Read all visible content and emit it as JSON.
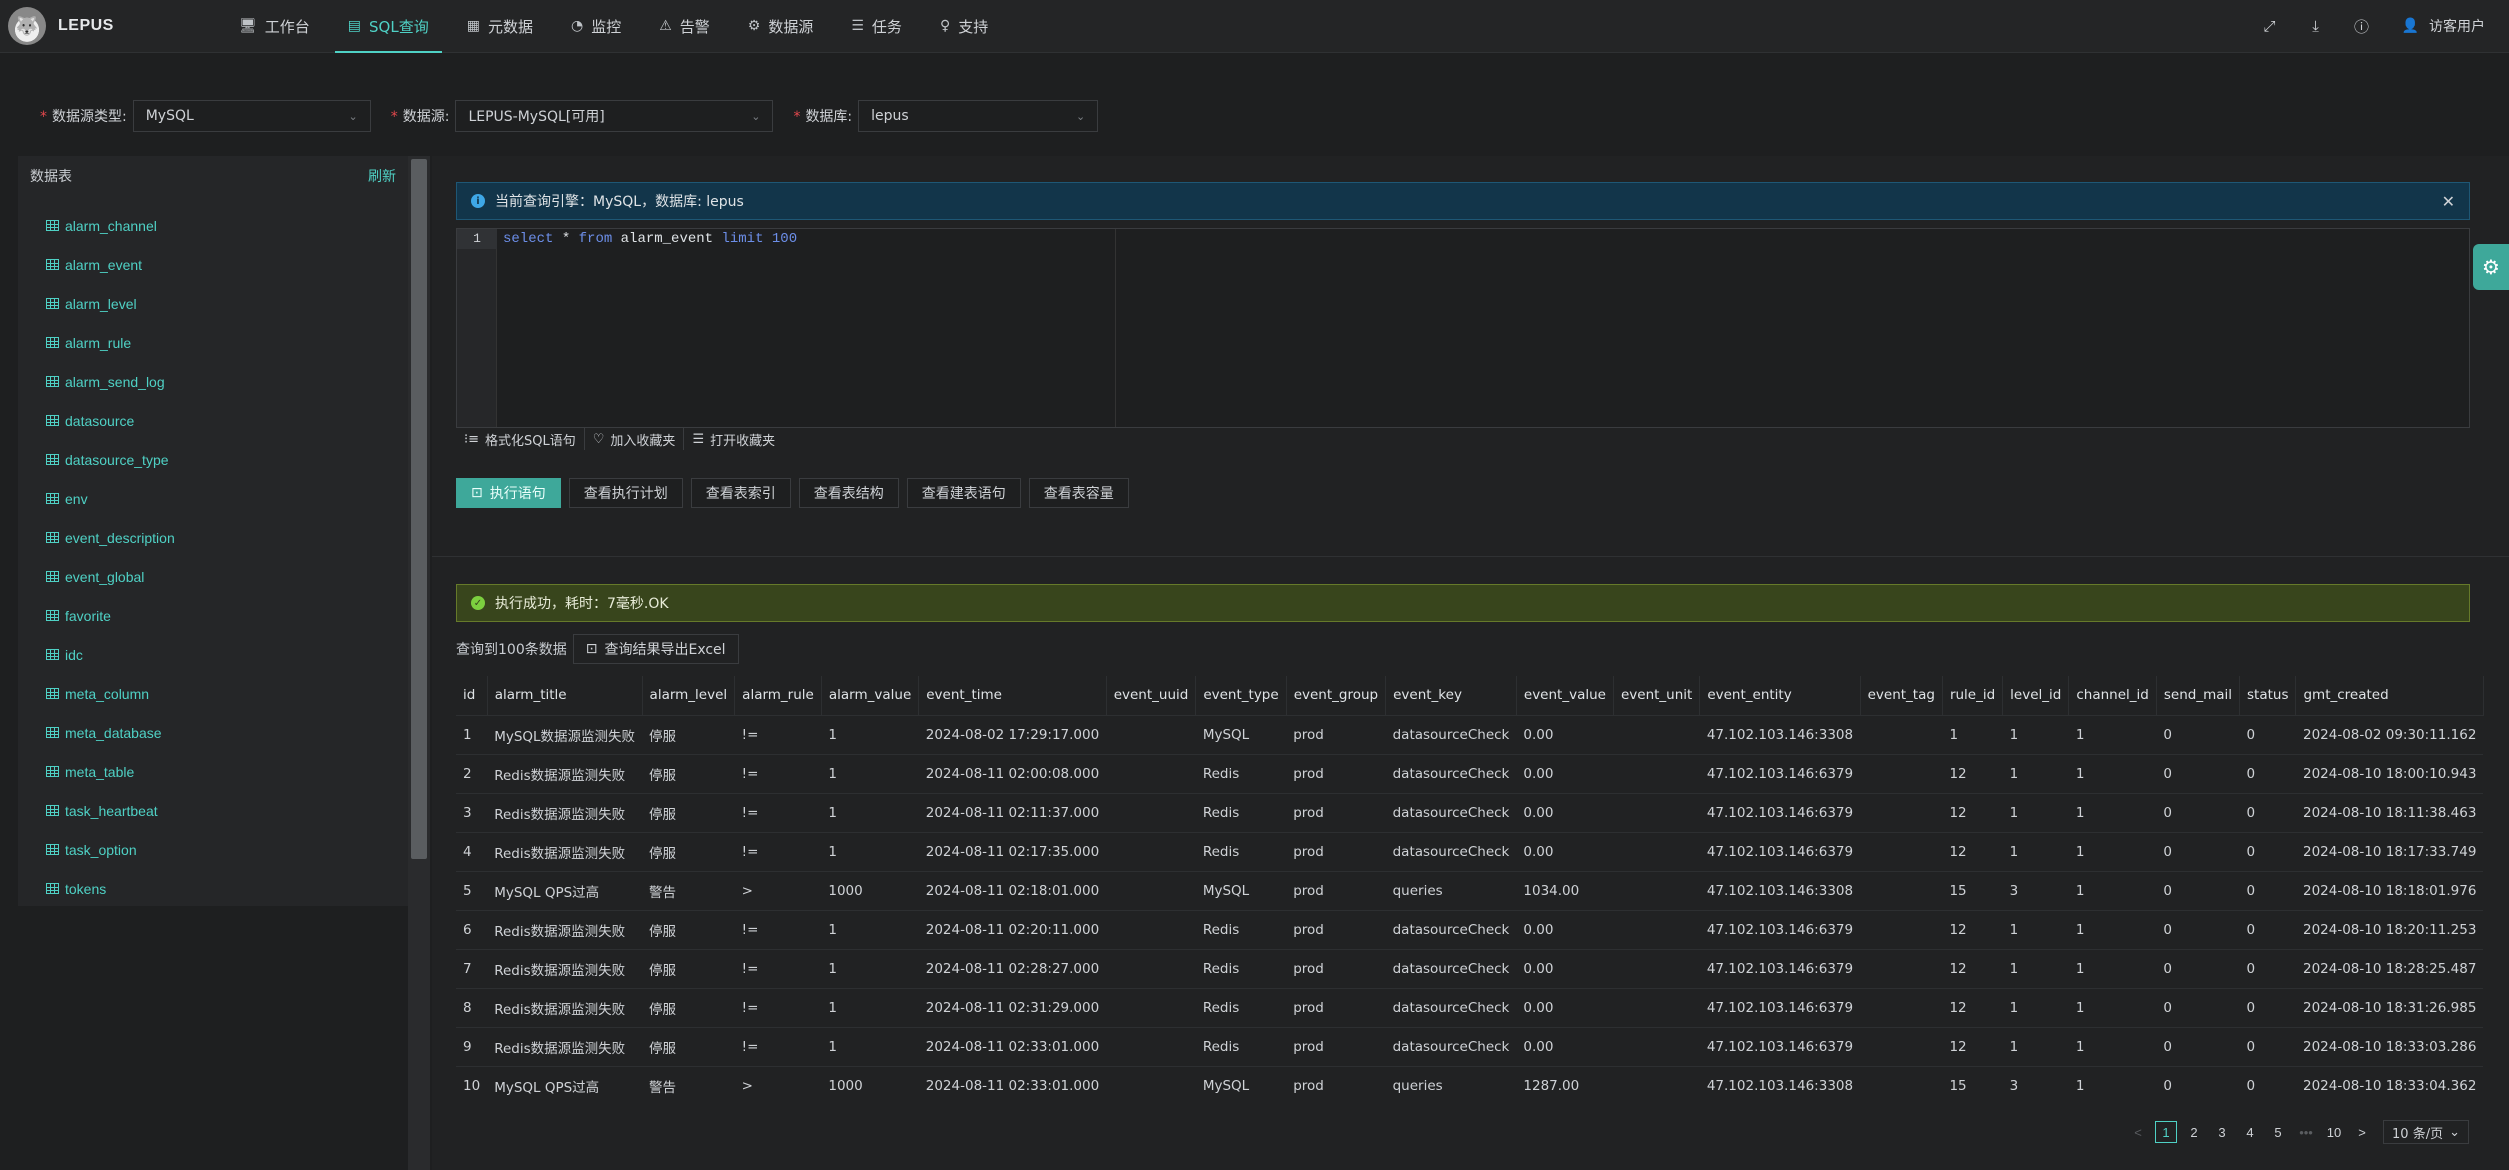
{
  "app": {
    "name": "LEPUS"
  },
  "nav": [
    {
      "label": "工作台",
      "icon": "monitor-icon",
      "glyph": "🖥",
      "active": false
    },
    {
      "label": "SQL查询",
      "icon": "sql-icon",
      "glyph": "▤",
      "active": true
    },
    {
      "label": "元数据",
      "icon": "metadata-icon",
      "glyph": "▦",
      "active": false
    },
    {
      "label": "监控",
      "icon": "gauge-icon",
      "glyph": "◔",
      "active": false
    },
    {
      "label": "告警",
      "icon": "warning-icon",
      "glyph": "⚠",
      "active": false
    },
    {
      "label": "数据源",
      "icon": "gear-icon",
      "glyph": "⚙",
      "active": false
    },
    {
      "label": "任务",
      "icon": "task-list-icon",
      "glyph": "☰",
      "active": false
    },
    {
      "label": "支持",
      "icon": "bulb-icon",
      "glyph": "♀",
      "active": false
    }
  ],
  "user": {
    "name": "访客用户"
  },
  "filters": {
    "datasource_type_label": "数据源类型:",
    "datasource_type_value": "MySQL",
    "datasource_label": "数据源:",
    "datasource_value": "LEPUS-MySQL[可用]",
    "database_label": "数据库:",
    "database_value": "lepus"
  },
  "sidebar": {
    "title": "数据表",
    "refresh_label": "刷新",
    "tables": [
      "alarm_channel",
      "alarm_event",
      "alarm_level",
      "alarm_rule",
      "alarm_send_log",
      "datasource",
      "datasource_type",
      "env",
      "event_description",
      "event_global",
      "favorite",
      "idc",
      "meta_column",
      "meta_database",
      "meta_table",
      "task_heartbeat",
      "task_option",
      "tokens"
    ]
  },
  "info_alert": {
    "text": "当前查询引擎：MySQL，数据库: lepus"
  },
  "editor": {
    "line_number": "1",
    "tokens": [
      {
        "t": "select",
        "c": "kw"
      },
      {
        "t": " * ",
        "c": "tx"
      },
      {
        "t": "from",
        "c": "kw"
      },
      {
        "t": " alarm_event ",
        "c": "tx"
      },
      {
        "t": "limit",
        "c": "kw"
      },
      {
        "t": " 100",
        "c": "num"
      }
    ]
  },
  "editor_tools": {
    "format_label": "格式化SQL语句",
    "add_fav_label": "加入收藏夹",
    "open_fav_label": "打开收藏夹"
  },
  "actions": {
    "execute": "执行语句",
    "explain": "查看执行计划",
    "indexes": "查看表索引",
    "structure": "查看表结构",
    "ddl": "查看建表语句",
    "capacity": "查看表容量"
  },
  "success_alert": {
    "text": "执行成功，耗时：7毫秒.OK"
  },
  "result": {
    "count_text": "查询到100条数据",
    "export_label": "查询结果导出Excel"
  },
  "table": {
    "columns": [
      "id",
      "alarm_title",
      "alarm_level",
      "alarm_rule",
      "alarm_value",
      "event_time",
      "event_uuid",
      "event_type",
      "event_group",
      "event_key",
      "event_value",
      "event_unit",
      "event_entity",
      "event_tag",
      "rule_id",
      "level_id",
      "channel_id",
      "send_mail",
      "status",
      "gmt_created"
    ],
    "rows": [
      [
        "1",
        "MySQL数据源监测失败",
        "停服",
        "!=",
        "1",
        "2024-08-02 17:29:17.000",
        "",
        "MySQL",
        "prod",
        "datasourceCheck",
        "0.00",
        "",
        "47.102.103.146:3308",
        "",
        "1",
        "1",
        "1",
        "0",
        "0",
        "2024-08-02 09:30:11.162"
      ],
      [
        "2",
        "Redis数据源监测失败",
        "停服",
        "!=",
        "1",
        "2024-08-11 02:00:08.000",
        "",
        "Redis",
        "prod",
        "datasourceCheck",
        "0.00",
        "",
        "47.102.103.146:6379",
        "",
        "12",
        "1",
        "1",
        "0",
        "0",
        "2024-08-10 18:00:10.943"
      ],
      [
        "3",
        "Redis数据源监测失败",
        "停服",
        "!=",
        "1",
        "2024-08-11 02:11:37.000",
        "",
        "Redis",
        "prod",
        "datasourceCheck",
        "0.00",
        "",
        "47.102.103.146:6379",
        "",
        "12",
        "1",
        "1",
        "0",
        "0",
        "2024-08-10 18:11:38.463"
      ],
      [
        "4",
        "Redis数据源监测失败",
        "停服",
        "!=",
        "1",
        "2024-08-11 02:17:35.000",
        "",
        "Redis",
        "prod",
        "datasourceCheck",
        "0.00",
        "",
        "47.102.103.146:6379",
        "",
        "12",
        "1",
        "1",
        "0",
        "0",
        "2024-08-10 18:17:33.749"
      ],
      [
        "5",
        "MySQL QPS过高",
        "警告",
        ">",
        "1000",
        "2024-08-11 02:18:01.000",
        "",
        "MySQL",
        "prod",
        "queries",
        "1034.00",
        "",
        "47.102.103.146:3308",
        "",
        "15",
        "3",
        "1",
        "0",
        "0",
        "2024-08-10 18:18:01.976"
      ],
      [
        "6",
        "Redis数据源监测失败",
        "停服",
        "!=",
        "1",
        "2024-08-11 02:20:11.000",
        "",
        "Redis",
        "prod",
        "datasourceCheck",
        "0.00",
        "",
        "47.102.103.146:6379",
        "",
        "12",
        "1",
        "1",
        "0",
        "0",
        "2024-08-10 18:20:11.253"
      ],
      [
        "7",
        "Redis数据源监测失败",
        "停服",
        "!=",
        "1",
        "2024-08-11 02:28:27.000",
        "",
        "Redis",
        "prod",
        "datasourceCheck",
        "0.00",
        "",
        "47.102.103.146:6379",
        "",
        "12",
        "1",
        "1",
        "0",
        "0",
        "2024-08-10 18:28:25.487"
      ],
      [
        "8",
        "Redis数据源监测失败",
        "停服",
        "!=",
        "1",
        "2024-08-11 02:31:29.000",
        "",
        "Redis",
        "prod",
        "datasourceCheck",
        "0.00",
        "",
        "47.102.103.146:6379",
        "",
        "12",
        "1",
        "1",
        "0",
        "0",
        "2024-08-10 18:31:26.985"
      ],
      [
        "9",
        "Redis数据源监测失败",
        "停服",
        "!=",
        "1",
        "2024-08-11 02:33:01.000",
        "",
        "Redis",
        "prod",
        "datasourceCheck",
        "0.00",
        "",
        "47.102.103.146:6379",
        "",
        "12",
        "1",
        "1",
        "0",
        "0",
        "2024-08-10 18:33:03.286"
      ],
      [
        "10",
        "MySQL QPS过高",
        "警告",
        ">",
        "1000",
        "2024-08-11 02:33:01.000",
        "",
        "MySQL",
        "prod",
        "queries",
        "1287.00",
        "",
        "47.102.103.146:3308",
        "",
        "15",
        "3",
        "1",
        "0",
        "0",
        "2024-08-10 18:33:04.362"
      ]
    ]
  },
  "pagination": {
    "prev": "<",
    "pages": [
      "1",
      "2",
      "3",
      "4",
      "5"
    ],
    "ellipsis": "•••",
    "last": "10",
    "next": ">",
    "current": "1",
    "page_size": "10 条/页"
  },
  "colors": {
    "accent": "#4fd1c5",
    "primary_button": "#3ea89a",
    "info_bg": "#12354a",
    "success_bg": "#38451c"
  }
}
